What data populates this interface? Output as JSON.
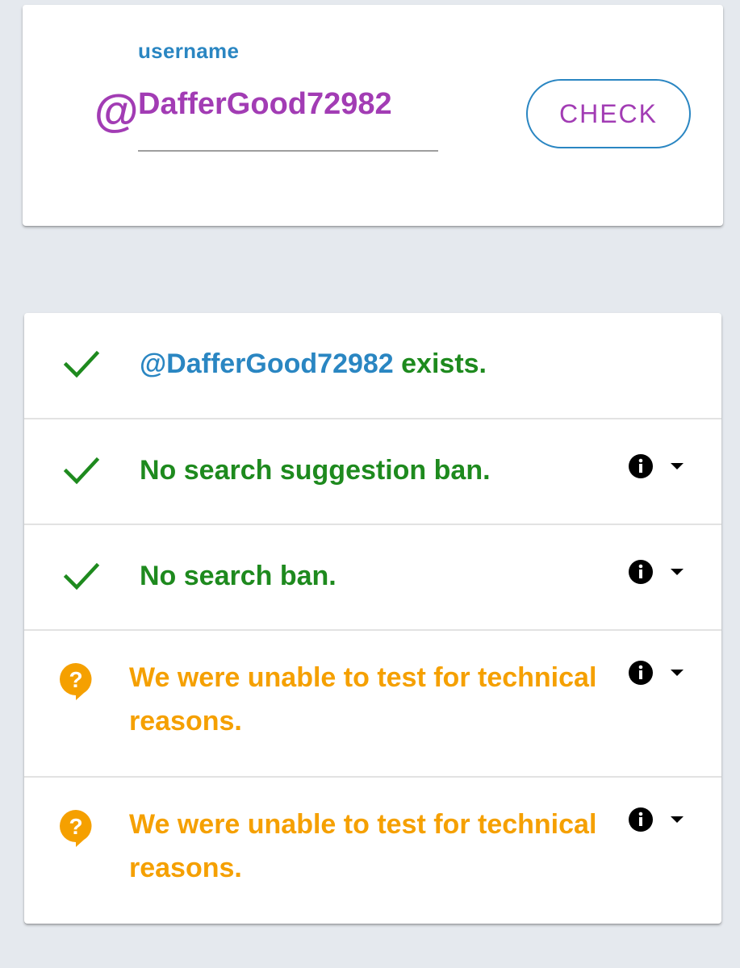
{
  "search": {
    "label": "username",
    "value": "DafferGood72982",
    "prefix_icon": "at-sign-icon",
    "button_label": "CHECK"
  },
  "results": [
    {
      "status": "ok",
      "icon": "checkmark-icon",
      "handle": "@DafferGood72982",
      "text": " exists.",
      "has_info": false
    },
    {
      "status": "ok",
      "icon": "checkmark-icon",
      "text": "No search suggestion ban.",
      "has_info": true
    },
    {
      "status": "ok",
      "icon": "checkmark-icon",
      "text": "No search ban.",
      "has_info": true
    },
    {
      "status": "unknown",
      "icon": "question-bubble-icon",
      "text_line1": "We were unable to test for technical",
      "text_line2": "reasons.",
      "has_info": true
    },
    {
      "status": "unknown",
      "icon": "question-bubble-icon",
      "text_line1": "We were unable to test for technical",
      "text_line2": "reasons.",
      "has_info": true
    }
  ],
  "colors": {
    "accent_purple": "#a23cb4",
    "accent_blue": "#2a86c2",
    "ok_green": "#1e8a1e",
    "warn_orange": "#f5a000",
    "background": "#e5e9ee"
  }
}
